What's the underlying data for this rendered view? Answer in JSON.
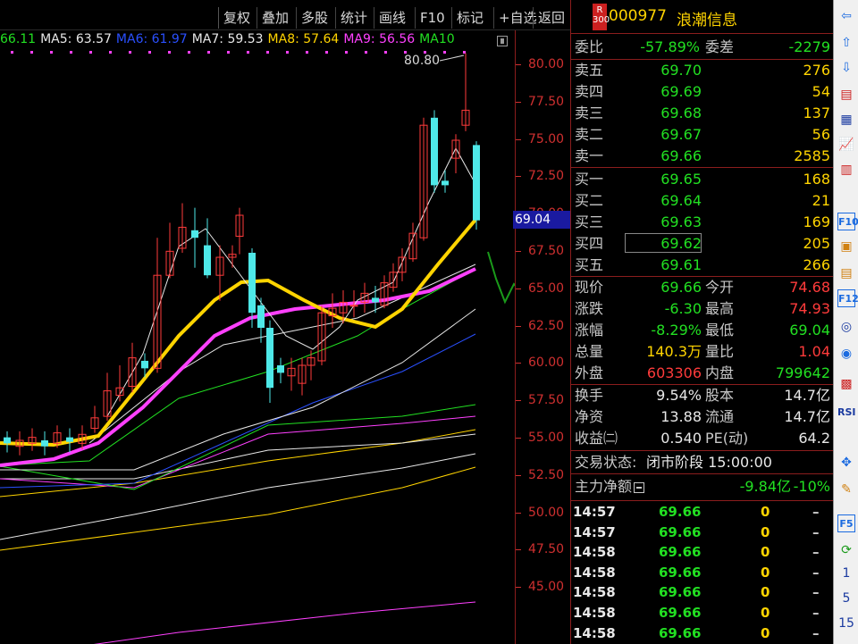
{
  "toolbar": {
    "buttons": [
      "复权",
      "叠加",
      "多股",
      "统计",
      "画线",
      "F10",
      "标记",
      "+自选",
      "返回"
    ]
  },
  "ma_legend": [
    {
      "text": "66.11",
      "color": "#22e022"
    },
    {
      "text": "MA5: 63.57",
      "color": "#e8e8e8"
    },
    {
      "text": "MA6: 61.97",
      "color": "#2a50ff"
    },
    {
      "text": "MA7: 59.53",
      "color": "#e8e8e8"
    },
    {
      "text": "MA8: 57.64",
      "color": "#ffd400"
    },
    {
      "text": "MA9: 56.56",
      "color": "#ff40ff"
    },
    {
      "text": "MA10",
      "color": "#22e022"
    }
  ],
  "chart": {
    "high_label": "80.80",
    "current_price_marker": "69.04",
    "price_ticks": [
      "80.00",
      "77.50",
      "75.00",
      "72.50",
      "70.00",
      "67.50",
      "65.00",
      "62.50",
      "60.00",
      "57.50",
      "55.00",
      "52.50",
      "50.00",
      "47.50",
      "45.00"
    ]
  },
  "stock": {
    "badge": "R\n300",
    "code": "000977",
    "name": "浪潮信息"
  },
  "order_ratio": {
    "label": "委比",
    "value": "-57.89%",
    "label2": "委差",
    "value2": "-2279"
  },
  "asks": [
    {
      "label": "卖五",
      "price": "69.70",
      "vol": "276"
    },
    {
      "label": "卖四",
      "price": "69.69",
      "vol": "54"
    },
    {
      "label": "卖三",
      "price": "69.68",
      "vol": "137"
    },
    {
      "label": "卖二",
      "price": "69.67",
      "vol": "56"
    },
    {
      "label": "卖一",
      "price": "69.66",
      "vol": "2585"
    }
  ],
  "bids": [
    {
      "label": "买一",
      "price": "69.65",
      "vol": "168"
    },
    {
      "label": "买二",
      "price": "69.64",
      "vol": "21"
    },
    {
      "label": "买三",
      "price": "69.63",
      "vol": "169"
    },
    {
      "label": "买四",
      "price": "69.62",
      "vol": "205"
    },
    {
      "label": "买五",
      "price": "69.61",
      "vol": "266"
    }
  ],
  "stats": [
    {
      "l1": "现价",
      "v1": "69.66",
      "c1": "green",
      "l2": "今开",
      "v2": "74.68",
      "c2": "red"
    },
    {
      "l1": "涨跌",
      "v1": "-6.30",
      "c1": "green",
      "l2": "最高",
      "v2": "74.93",
      "c2": "red"
    },
    {
      "l1": "涨幅",
      "v1": "-8.29%",
      "c1": "green",
      "l2": "最低",
      "v2": "69.04",
      "c2": "green"
    },
    {
      "l1": "总量",
      "v1": "140.3万",
      "c1": "yellow",
      "l2": "量比",
      "v2": "1.04",
      "c2": "red"
    },
    {
      "l1": "外盘",
      "v1": "603306",
      "c1": "red",
      "l2": "内盘",
      "v2": "799642",
      "c2": "green"
    }
  ],
  "stats2": [
    {
      "l1": "换手",
      "v1": "9.54%",
      "c1": "white",
      "l2": "股本",
      "v2": "14.7亿",
      "c2": "white"
    },
    {
      "l1": "净资",
      "v1": "13.88",
      "c1": "white",
      "l2": "流通",
      "v2": "14.7亿",
      "c2": "white"
    },
    {
      "l1": "收益㈡",
      "v1": "0.540",
      "c1": "white",
      "l2": "PE(动)",
      "v2": "64.2",
      "c2": "white"
    }
  ],
  "trade_status": {
    "label": "交易状态:",
    "value": "闭市阶段 15:00:00"
  },
  "main_flow": {
    "label": "主力净额",
    "value": "-9.84亿",
    "pct": "-10%"
  },
  "ticks": [
    {
      "time": "14:57",
      "price": "69.66",
      "vol": "0",
      "dir": "–"
    },
    {
      "time": "14:57",
      "price": "69.66",
      "vol": "0",
      "dir": "–"
    },
    {
      "time": "14:58",
      "price": "69.66",
      "vol": "0",
      "dir": "–"
    },
    {
      "time": "14:58",
      "price": "69.66",
      "vol": "0",
      "dir": "–"
    },
    {
      "time": "14:58",
      "price": "69.66",
      "vol": "0",
      "dir": "–"
    },
    {
      "time": "14:58",
      "price": "69.66",
      "vol": "0",
      "dir": "–"
    },
    {
      "time": "14:58",
      "price": "69.66",
      "vol": "0",
      "dir": "–"
    }
  ],
  "sidebar": {
    "icons": [
      "arrow-left-icon",
      "arrow-up-icon",
      "arrow-down-icon",
      "report-icon",
      "grid-icon",
      "line-chart-icon",
      "candle-icon",
      "f10-icon",
      "finance-icon",
      "notebook-icon",
      "f12-icon",
      "compass-icon",
      "target-icon",
      "chart-icon",
      "rsi-icon",
      "cross-arrows-icon",
      "pencil-icon",
      "f5-icon",
      "refresh-icon"
    ],
    "rsi_label": "RSI",
    "f10_label": "F10",
    "f12_label": "F12",
    "f5_label": "F5",
    "periods": [
      "1",
      "5",
      "15"
    ]
  }
}
